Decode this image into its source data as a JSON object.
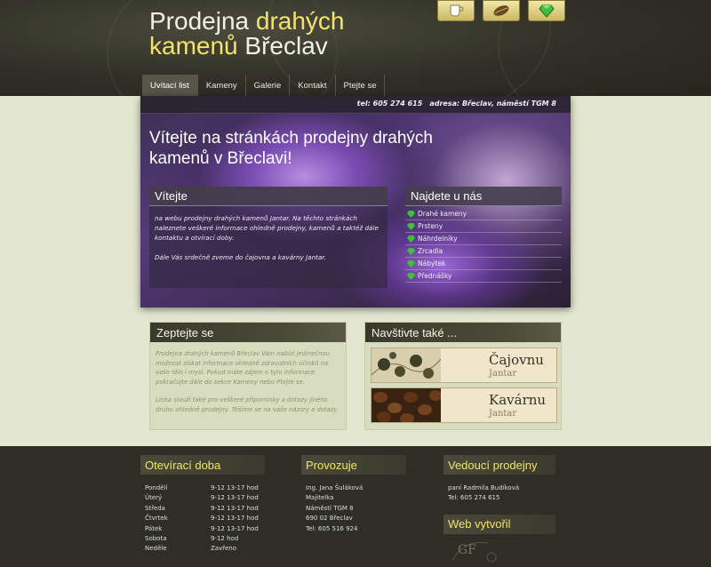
{
  "header": {
    "title_line1_plain": "Prodejna ",
    "title_line1_highlight": "drahých",
    "title_line2_highlight": "kamenů",
    "title_line2_plain": " Břeclav",
    "icons": [
      "tea-cup-icon",
      "coffee-bean-icon",
      "gem-icon"
    ]
  },
  "nav": {
    "items": [
      "Uvítací list",
      "Kameny",
      "Galerie",
      "Kontakt",
      "Ptejte se"
    ]
  },
  "hero": {
    "phone": "tel: 605 274 615",
    "address": "adresa: Břeclav, náměstí TGM 8",
    "title": "Vítejte na stránkách prodejny drahých kamenů v Břeclavi!"
  },
  "welcome": {
    "heading": "Vítejte",
    "p1": "na webu prodejny drahých kamenů Jantar. Na těchto stránkách naleznete veškeré informace ohledně prodejny, kamenů a taktéž dále kontaktu a otvírací doby.",
    "p2": "Dále Vás srdečně zveme do čajovna a kavárny Jantar."
  },
  "find": {
    "heading": "Najdete u nás",
    "items": [
      "Drahé kameny",
      "Prsteny",
      "Náhrdelníky",
      "Zrcadla",
      "Nábytek",
      "Přednášky"
    ]
  },
  "ask": {
    "heading": "Zeptejte se",
    "p1": "Prodejna drahých kamenů Břeclav Vám nabízí jedinečnou možnost získat informace ohledně zdravotních účinků na vaše tělo i mysl. Pokud máte zájem o tyto informace pokračujte dále do sekce Kameny nebo Ptejte se.",
    "p2": "Linka slouží také pro veškeré připomínky a dotazy jiného druhu ohledně prodejny. Těšíme se na vaše názory a dotazy."
  },
  "visit": {
    "heading": "Navštivte také ...",
    "banners": [
      {
        "big": "Čajovnu",
        "small": "Jantar"
      },
      {
        "big": "Kavárnu",
        "small": "Jantar"
      }
    ]
  },
  "footer": {
    "hours": {
      "heading": "Otevírací doba",
      "rows": [
        {
          "day": "Pondělí",
          "time": "9-12  13-17 hod"
        },
        {
          "day": "Úterý",
          "time": "9-12  13-17 hod"
        },
        {
          "day": "Středa",
          "time": "9-12  13-17 hod"
        },
        {
          "day": "Čtvrtek",
          "time": "9-12  13-17 hod"
        },
        {
          "day": "Pátek",
          "time": "9-12  13-17 hod"
        },
        {
          "day": "Sobota",
          "time": "9-12 hod"
        },
        {
          "day": "Neděle",
          "time": "Zavřeno"
        }
      ]
    },
    "provoz": {
      "heading": "Provozuje",
      "lines": [
        "Ing. Jana Šuláková",
        "Majitelka",
        "Náměstí TGM 8",
        "690 02 Břeclav",
        "Tel: 605 516 924"
      ]
    },
    "manager": {
      "heading": "Vedoucí prodejny",
      "lines": [
        "paní Radmila Budíková",
        "Tel: 605 274 615"
      ]
    },
    "credit": {
      "heading": "Web vytvořil",
      "logo": "GF"
    }
  },
  "colors": {
    "accent": "#f3e36a",
    "footer_bg": "#2e2e26",
    "page_bg": "#e3e7cf"
  }
}
